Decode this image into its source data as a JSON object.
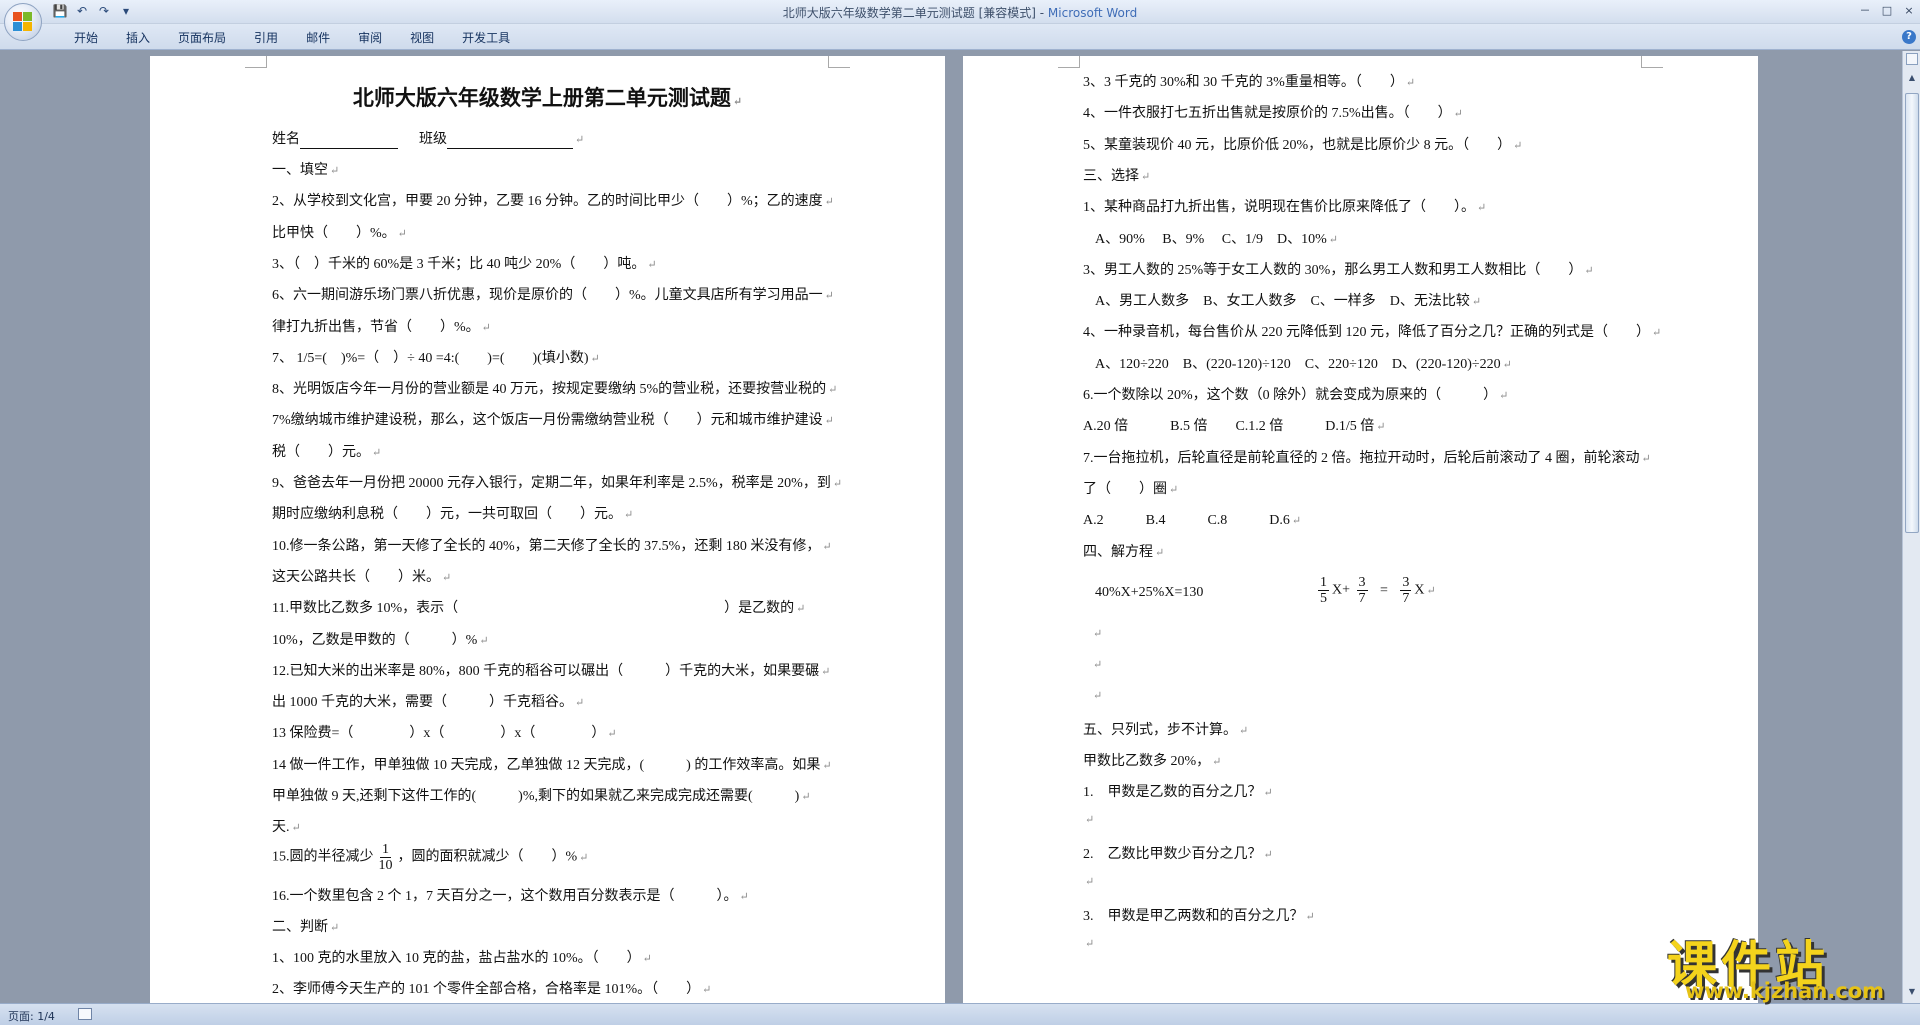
{
  "window": {
    "title": "北师大版六年级数学第二单元测试题 [兼容模式] - ",
    "app_name": "Microsoft Word",
    "controls": [
      "－",
      "□",
      "×"
    ]
  },
  "qat": {
    "save": "💾",
    "undo": "↶",
    "redo": "↷",
    "customize": "▾"
  },
  "ribbon": {
    "tabs": [
      "开始",
      "插入",
      "页面布局",
      "引用",
      "邮件",
      "审阅",
      "视图",
      "开发工具"
    ],
    "help": "?"
  },
  "page1": {
    "title": "北师大版六年级数学上册第二单元测试题",
    "name_line": "姓名",
    "class_line": "班级",
    "lines": [
      "一、填空",
      "2、从学校到文化宫，甲要 20 分钟，乙要 16 分钟。乙的时间比甲少（　　）%；乙的速度",
      "比甲快（　　）%。",
      "3、（　）千米的 60%是 3 千米；比 40 吨少 20%（　　）吨。",
      "6、六一期间游乐场门票八折优惠，现价是原价的（　　）%。儿童文具店所有学习用品一",
      "律打九折出售，节省（　　）%。",
      "7、 1/5=(　)%=（　）÷ 40 =4:(　　)=(　　)(填小数)",
      "8、光明饭店今年一月份的营业额是 40 万元，按规定要缴纳 5%的营业税，还要按营业税的",
      "7%缴纳城市维护建设税，那么，这个饭店一月份需缴纳营业税（　　）元和城市维护建设",
      "税（　　）元。",
      "9、爸爸去年一月份把 20000 元存入银行，定期二年，如果年利率是 2.5%，税率是 20%，到",
      "期时应缴纳利息税（　　）元，一共可取回（　　）元。",
      "10.修一条公路，第一天修了全长的 40%，第二天修了全长的 37.5%，还剩 180 米没有修，",
      "这天公路共长（　　）米。",
      "11.甲数比乙数多 10%，表示（　　　　　　　　　　　　　　　　　　　）是乙数的",
      "10%，乙数是甲数的（　　　）%",
      "12.已知大米的出米率是 80%，800 千克的稻谷可以碾出（　　　）千克的大米，如果要碾",
      "出 1000 千克的大米，需要（　　　）千克稻谷。",
      "13 保险费=（　　　　）x（　　　　）x（　　　　）",
      "14 做一件工作，甲单独做 10 天完成，乙单独做 12 天完成，(　　　) 的工作效率高。如果",
      "甲单独做 9 天,还剩下这件工作的(　　　)%,剩下的如果就乙来完成完成还需要(　　　)",
      "天."
    ],
    "line15_a": "15.圆的半径减少",
    "line15_num": "1",
    "line15_den": "10",
    "line15_b": "，圆的面积就减少（　　）%",
    "lines_after": [
      "16.一个数里包含 2 个 1，7 天百分之一，这个数用百分数表示是（　　　）。",
      "二、判断",
      "1、100 克的水里放入 10 克的盐，盐占盐水的 10%。（　　）",
      "2、李师傅今天生产的 101 个零件全部合格，合格率是 101%。（　　）"
    ]
  },
  "page2": {
    "lines": [
      "3、3 千克的 30%和 30 千克的 3%重量相等。（　　）",
      "4、一件衣服打七五折出售就是按原价的 7.5%出售。（　　）",
      "5、某童装现价 40 元，比原价低 20%，也就是比原价少 8 元。（　　）",
      "三、选择",
      "1、某种商品打九折出售，说明现在售价比原来降低了（　　）。",
      "A、90%　 B、9%　 C、1/9　D、10%",
      "3、男工人数的 25%等于女工人数的 30%，那么男工人数和男工人数相比（　　）",
      "A、男工人数多　B、女工人数多　C、一样多　D、无法比较",
      "4、一种录音机，每台售价从 220 元降低到 120 元，降低了百分之几？正确的列式是（　　）",
      "A、120÷220　B、(220-120)÷120　C、220÷120　D、(220-120)÷220",
      "6.一个数除以 20%，这个数（0 除外）就会变成为原来的（　　　）",
      "A.20 倍　　　B.5 倍　　C.1.2 倍　　　D.1/5 倍",
      "7.一台拖拉机，后轮直径是前轮直径的 2 倍。拖拉开动时，后轮后前滚动了 4 圈，前轮滚动",
      "了（　　）圈",
      "A.2　　　B.4　　　C.8　　　D.6",
      "四、解方程"
    ],
    "eq1": "40%X+25%X=130",
    "eq2_f1_num": "1",
    "eq2_f1_den": "5",
    "eq2_x1": "X+",
    "eq2_f2_num": "3",
    "eq2_f2_den": "7",
    "eq2_eq": "=",
    "eq2_f3_num": "3",
    "eq2_f3_den": "7",
    "eq2_x2": "X",
    "lines_after": [
      "五、只列式，步不计算。",
      "甲数比乙数多 20%，",
      "1.　甲数是乙数的百分之几？",
      "2.　乙数比甲数少百分之几？",
      "3.　甲数是甲乙两数和的百分之几？"
    ]
  },
  "para_mark": "↵",
  "statusbar": {
    "page_info": "页面: 1/4"
  },
  "watermark": {
    "text": "课件站",
    "url": "www.kjzhan.com"
  }
}
